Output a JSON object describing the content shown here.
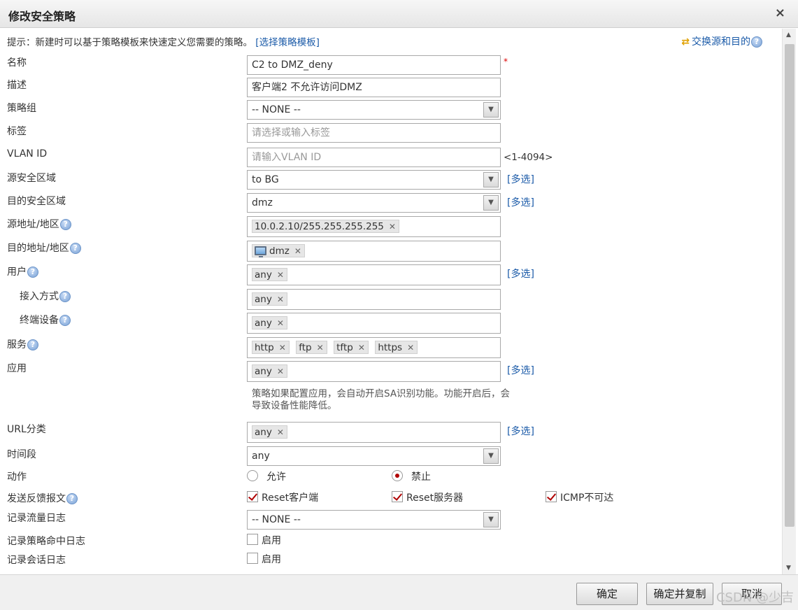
{
  "dialog": {
    "title": "修改安全策略",
    "close": "×"
  },
  "hint": {
    "text": "提示：新建时可以基于策略模板来快速定义您需要的策略。",
    "link": "[选择策略模板]",
    "swap": "交换源和目的"
  },
  "help": "?",
  "required_mark": "*",
  "multi_select": "[多选]",
  "fields": {
    "name": {
      "label": "名称",
      "value": "C2 to DMZ_deny"
    },
    "desc": {
      "label": "描述",
      "value": "客户端2 不允许访问DMZ"
    },
    "group": {
      "label": "策略组",
      "value": "-- NONE --"
    },
    "tags": {
      "label": "标签",
      "placeholder": "请选择或输入标签"
    },
    "vlan": {
      "label": "VLAN ID",
      "placeholder": "请输入VLAN ID",
      "range": "<1-4094>"
    },
    "src_zone": {
      "label": "源安全区域",
      "value": "to BG"
    },
    "dst_zone": {
      "label": "目的安全区域",
      "value": "dmz"
    },
    "src_addr": {
      "label": "源地址/地区",
      "tags": [
        "10.0.2.10/255.255.255.255"
      ]
    },
    "dst_addr": {
      "label": "目的地址/地区",
      "tags": [
        "dmz"
      ]
    },
    "user": {
      "label": "用户",
      "tags": [
        "any"
      ]
    },
    "access": {
      "label": "接入方式",
      "tags": [
        "any"
      ]
    },
    "terminal": {
      "label": "终端设备",
      "tags": [
        "any"
      ]
    },
    "service": {
      "label": "服务",
      "tags": [
        "http",
        "ftp",
        "tftp",
        "https"
      ]
    },
    "app": {
      "label": "应用",
      "tags": [
        "any"
      ],
      "note": "策略如果配置应用，会自动开启SA识别功能。功能开启后，会导致设备性能降低。"
    },
    "url": {
      "label": "URL分类",
      "tags": [
        "any"
      ]
    },
    "time": {
      "label": "时间段",
      "value": "any"
    },
    "action": {
      "label": "动作",
      "options": [
        "允许",
        "禁止"
      ],
      "selected": "禁止"
    },
    "feedback": {
      "label": "发送反馈报文",
      "options": [
        "Reset客户端",
        "Reset服务器",
        "ICMP不可达"
      ]
    },
    "traffic_log": {
      "label": "记录流量日志",
      "value": "-- NONE --"
    },
    "hit_log": {
      "label": "记录策略命中日志",
      "option": "启用"
    },
    "session_log": {
      "label": "记录会话日志",
      "option": "启用"
    }
  },
  "buttons": {
    "ok": "确定",
    "ok_copy": "确定并复制",
    "cancel": "取消"
  },
  "watermark": "CSDN @少吉"
}
